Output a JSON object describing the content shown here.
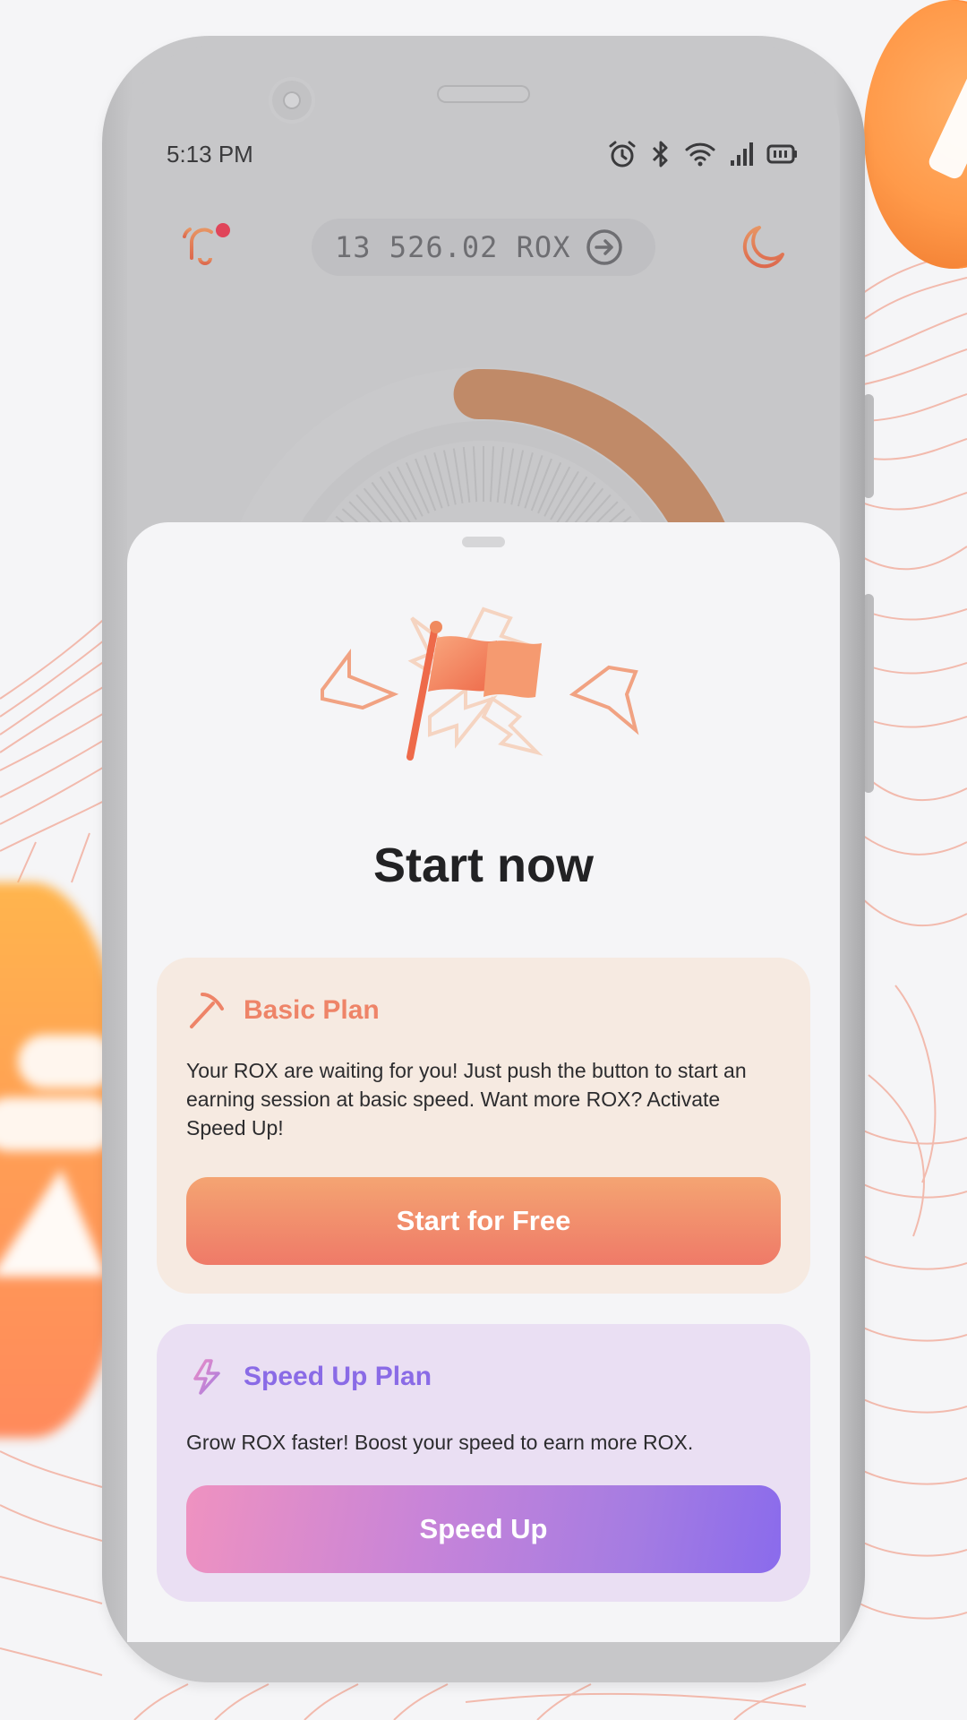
{
  "status_bar": {
    "time": "5:13 PM",
    "icons": [
      "alarm-icon",
      "bluetooth-icon",
      "wifi-icon",
      "signal-icon",
      "battery-icon"
    ]
  },
  "header": {
    "notification_icon": "bell-icon",
    "has_unread": true,
    "balance": "13 526.02 ROX",
    "balance_action_icon": "arrow-right-circle-icon",
    "theme_icon": "moon-icon"
  },
  "gauge": {
    "progress": 0.25
  },
  "sheet": {
    "illustration": "flag-with-lightning",
    "title": "Start now",
    "plans": [
      {
        "icon": "pickaxe-icon",
        "title": "Basic Plan",
        "description": "Your ROX are waiting for you! Just push the button to start an earning session at basic speed. Want more ROX? Activate Speed Up!",
        "button_label": "Start for Free"
      },
      {
        "icon": "lightning-icon",
        "title": "Speed Up Plan",
        "description": "Grow ROX faster! Boost your speed to earn more ROX.",
        "button_label": "Speed Up"
      }
    ]
  },
  "colors": {
    "accent_orange": "#ef7a68",
    "accent_purple": "#8a6bec",
    "basic_card_bg": "#f6eae1",
    "speed_card_bg": "#eadff3",
    "notification_dot": "#e0455a"
  }
}
